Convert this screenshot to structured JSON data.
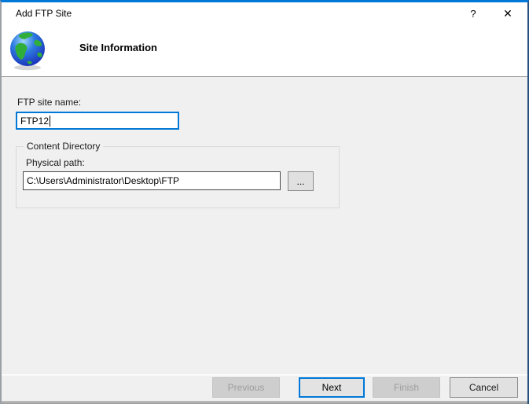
{
  "window": {
    "title": "Add FTP Site",
    "help_glyph": "?",
    "close_glyph": "✕"
  },
  "header": {
    "heading": "Site Information",
    "icon": "globe-icon"
  },
  "form": {
    "site_name": {
      "label": "FTP site name:",
      "value": "FTP12",
      "focused": true
    },
    "content_directory": {
      "group_label": "Content Directory",
      "physical_path": {
        "label": "Physical path:",
        "value": "C:\\Users\\Administrator\\Desktop\\FTP"
      },
      "browse_label": "..."
    }
  },
  "buttons": {
    "previous": {
      "label": "Previous",
      "enabled": false
    },
    "next": {
      "label": "Next",
      "enabled": true,
      "focused": true
    },
    "finish": {
      "label": "Finish",
      "enabled": false
    },
    "cancel": {
      "label": "Cancel",
      "enabled": true
    }
  },
  "colors": {
    "accent_blue": "#0078d7",
    "dialog_bg": "#f0f0f0",
    "header_bg": "#ffffff",
    "disabled_button_bg": "#cecece",
    "disabled_text": "#9d9d9d",
    "input_focus_border": "#0078d7"
  }
}
